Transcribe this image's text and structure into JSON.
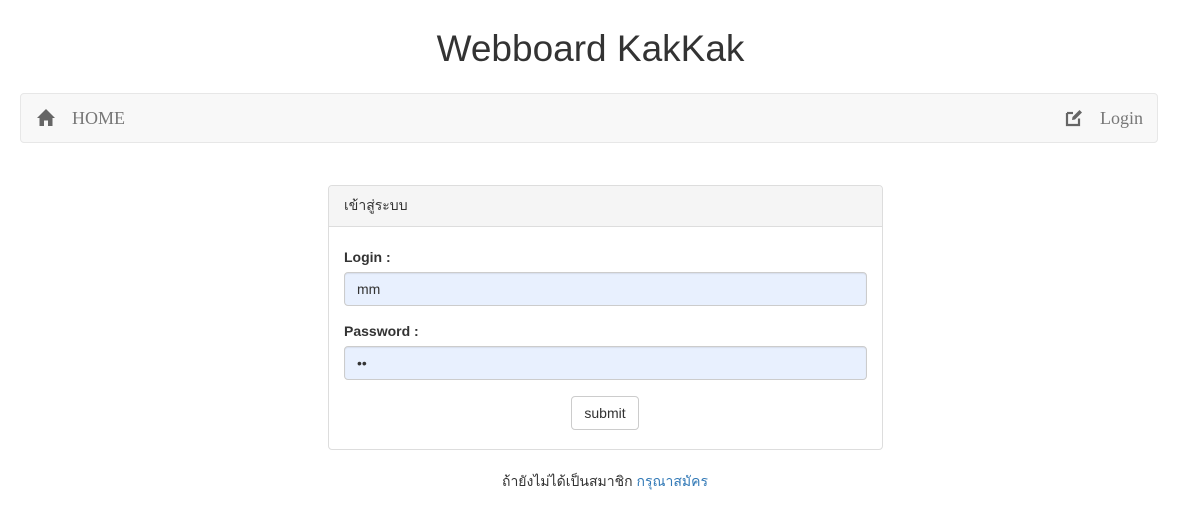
{
  "title": "Webboard KakKak",
  "navbar": {
    "home_label": "HOME",
    "home_icon": "home-icon",
    "login_label": "Login",
    "login_icon": "edit-icon"
  },
  "login_panel": {
    "heading": "เข้าสู่ระบบ",
    "login_label": "Login :",
    "login_value": "mm",
    "password_label": "Password :",
    "password_value": "••",
    "submit_label": "submit"
  },
  "register": {
    "prompt": "ถ้ายังไม่ได้เป็นสมาชิก",
    "link_label": "กรุณาสมัคร"
  },
  "colors": {
    "link": "#337ab7",
    "input_autofill_bg": "#e8f0fe",
    "navbar_bg": "#f8f8f8"
  }
}
